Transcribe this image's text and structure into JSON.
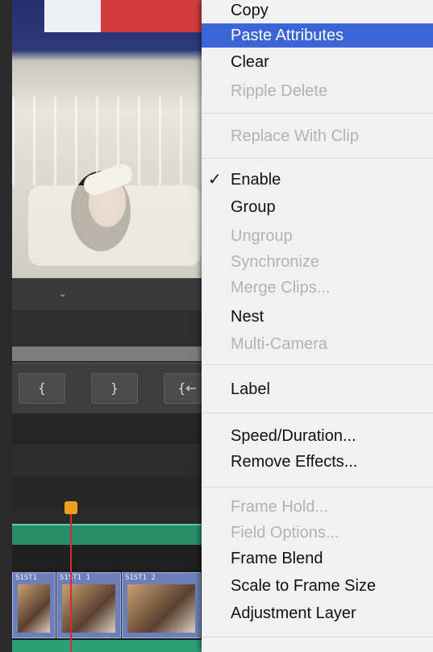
{
  "menu": {
    "items": [
      {
        "label": "Copy",
        "enabled": true,
        "highlighted": false,
        "checked": false
      },
      {
        "label": "Paste Attributes",
        "enabled": true,
        "highlighted": true,
        "checked": false
      },
      {
        "label": "Clear",
        "enabled": true,
        "highlighted": false,
        "checked": false
      },
      {
        "label": "Ripple Delete",
        "enabled": false,
        "highlighted": false,
        "checked": false
      },
      {
        "label": "Replace With Clip",
        "enabled": false,
        "highlighted": false,
        "checked": false
      },
      {
        "label": "Enable",
        "enabled": true,
        "highlighted": false,
        "checked": true
      },
      {
        "label": "Group",
        "enabled": true,
        "highlighted": false,
        "checked": false
      },
      {
        "label": "Ungroup",
        "enabled": false,
        "highlighted": false,
        "checked": false
      },
      {
        "label": "Synchronize",
        "enabled": false,
        "highlighted": false,
        "checked": false
      },
      {
        "label": "Merge Clips...",
        "enabled": false,
        "highlighted": false,
        "checked": false
      },
      {
        "label": "Nest",
        "enabled": true,
        "highlighted": false,
        "checked": false
      },
      {
        "label": "Multi-Camera",
        "enabled": false,
        "highlighted": false,
        "checked": false
      },
      {
        "label": "Label",
        "enabled": true,
        "highlighted": false,
        "checked": false
      },
      {
        "label": "Speed/Duration...",
        "enabled": true,
        "highlighted": false,
        "checked": false
      },
      {
        "label": "Remove Effects...",
        "enabled": true,
        "highlighted": false,
        "checked": false
      },
      {
        "label": "Frame Hold...",
        "enabled": false,
        "highlighted": false,
        "checked": false
      },
      {
        "label": "Field Options...",
        "enabled": false,
        "highlighted": false,
        "checked": false
      },
      {
        "label": "Frame Blend",
        "enabled": true,
        "highlighted": false,
        "checked": false
      },
      {
        "label": "Scale to Frame Size",
        "enabled": true,
        "highlighted": false,
        "checked": false
      },
      {
        "label": "Adjustment Layer",
        "enabled": true,
        "highlighted": false,
        "checked": false
      }
    ],
    "checkmark": "✓"
  },
  "transport": {
    "icons": [
      "mark-out-icon",
      "mark-in-icon",
      "go-to-in-icon"
    ],
    "glyphs": [
      "{",
      "}",
      "{←"
    ]
  },
  "timeline": {
    "clips": [
      "S1ST1",
      "S1ST1 1",
      "S1ST1 2"
    ]
  },
  "colors": {
    "menu_highlight": "#3b65d6",
    "menu_disabled_text": "#b3b3b3",
    "clip_fill": "#6c7fb8",
    "audio_track": "#2c9f76",
    "playhead": "#f0a020"
  }
}
